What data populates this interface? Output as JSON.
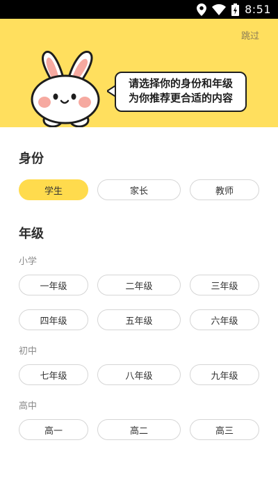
{
  "status_bar": {
    "time": "8:51",
    "icons": [
      "location-icon",
      "wifi-icon",
      "battery-charging-icon"
    ]
  },
  "header": {
    "skip_label": "跳过",
    "bubble_line1": "请选择你的身份和年级",
    "bubble_line2": "为你推荐更合适的内容",
    "colors": {
      "banner": "#FFDF5E",
      "accent": "#FFDB4D"
    }
  },
  "identity": {
    "title": "身份",
    "options": [
      "学生",
      "家长",
      "教师"
    ],
    "selected": "学生"
  },
  "grade": {
    "title": "年级",
    "groups": [
      {
        "label": "小学",
        "options": [
          "一年级",
          "二年级",
          "三年级",
          "四年级",
          "五年级",
          "六年级"
        ]
      },
      {
        "label": "初中",
        "options": [
          "七年级",
          "八年级",
          "九年级"
        ]
      },
      {
        "label": "高中",
        "options": [
          "高一",
          "高二",
          "高三"
        ]
      }
    ]
  }
}
